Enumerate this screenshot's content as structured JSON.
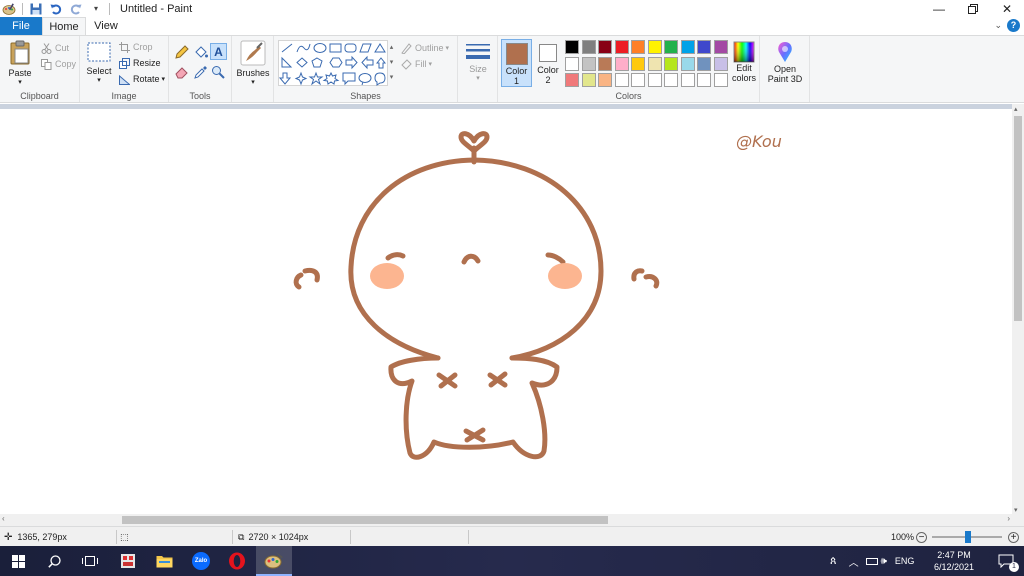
{
  "window": {
    "title": "Untitled - Paint"
  },
  "tabs": [
    {
      "label": "File"
    },
    {
      "label": "Home"
    },
    {
      "label": "View"
    }
  ],
  "ribbon": {
    "clipboard": {
      "paste": "Paste",
      "cut": "Cut",
      "copy": "Copy",
      "group": "Clipboard"
    },
    "image": {
      "select": "Select",
      "crop": "Crop",
      "resize": "Resize",
      "rotate": "Rotate",
      "group": "Image"
    },
    "tools": {
      "group": "Tools"
    },
    "brushes": {
      "label": "Brushes"
    },
    "shapes": {
      "outline": "Outline",
      "fill": "Fill",
      "group": "Shapes"
    },
    "size": {
      "label": "Size"
    },
    "colors": {
      "color1": "Color\n1",
      "color1_a": "Color",
      "color1_b": "1",
      "color2_a": "Color",
      "color2_b": "2",
      "edit_a": "Edit",
      "edit_b": "colors",
      "group": "Colors",
      "color1_value": "#b0704e",
      "color2_value": "#ffffff",
      "palette": [
        "#000000",
        "#7f7f7f",
        "#880015",
        "#ed1c24",
        "#ff7f27",
        "#fff200",
        "#22b14c",
        "#00a2e8",
        "#3f48cc",
        "#a349a4",
        "#ffffff",
        "#c3c3c3",
        "#b97a57",
        "#ffaec9",
        "#ffc90e",
        "#efe4b0",
        "#b5e61d",
        "#99d9ea",
        "#7092be",
        "#c8bfe7",
        "#f0797a",
        "#e2e68c",
        "#f9b484",
        "#ffffff",
        "#ffffff",
        "#ffffff",
        "#ffffff",
        "#ffffff",
        "#ffffff",
        "#ffffff"
      ]
    },
    "paint3d": {
      "line1": "Open",
      "line2": "Paint 3D"
    }
  },
  "canvas": {
    "stroke_color": "#b0704e",
    "cheek_color": "#fcb590",
    "signature": "@Kou"
  },
  "status": {
    "cursor": "1365, 279px",
    "dimensions": "2720 × 1024px",
    "zoom": "100%"
  },
  "taskbar": {
    "apps": [
      "start-icon",
      "search-icon",
      "task-view-icon",
      "snipping-tool-icon",
      "file-explorer-icon",
      "zalo-icon",
      "opera-icon",
      "paint-icon"
    ],
    "zalo_label": "Zalo",
    "language": "ENG",
    "time": "2:47 PM",
    "date": "6/12/2021",
    "notifications": "1"
  }
}
